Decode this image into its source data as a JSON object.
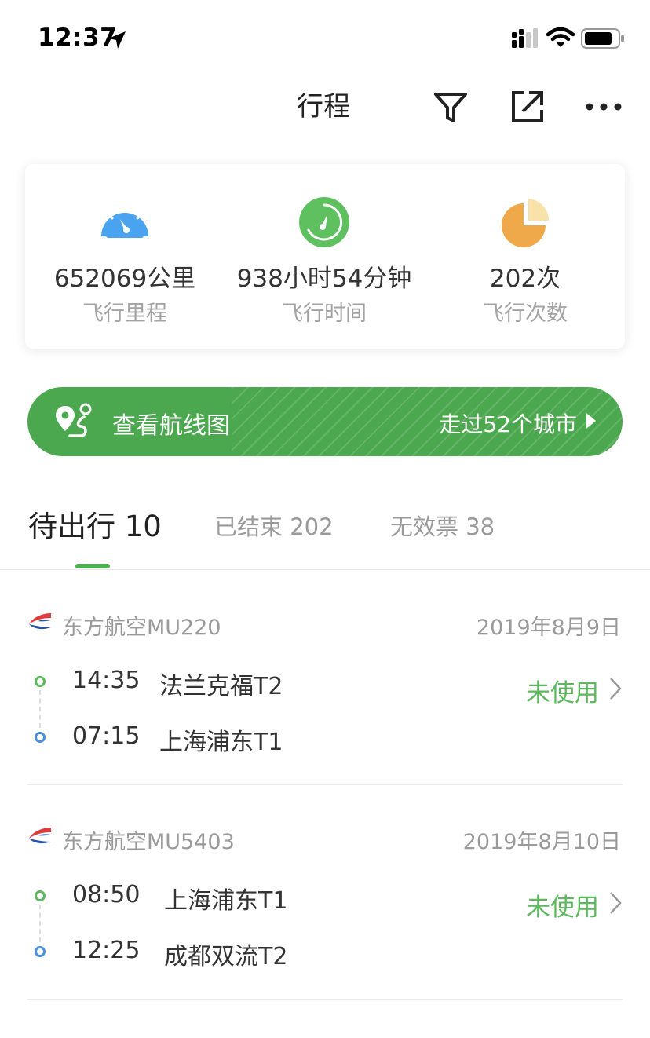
{
  "status_bar": {
    "time": "12:37"
  },
  "nav": {
    "title": "行程"
  },
  "stats": [
    {
      "value": "652069公里",
      "label": "飞行里程",
      "icon": "speedometer-icon",
      "color": "#4aa3ee"
    },
    {
      "value": "938小时54分钟",
      "label": "飞行时间",
      "icon": "clock-icon",
      "color": "#5fc05f"
    },
    {
      "value": "202次",
      "label": "飞行次数",
      "icon": "pie-chart-icon",
      "color": "#f0a94a"
    }
  ],
  "route_banner": {
    "label": "查看航线图",
    "cities": "走过52个城市"
  },
  "tabs": [
    {
      "label": "待出行 10",
      "active": true
    },
    {
      "label": "已结束 202",
      "active": false
    },
    {
      "label": "无效票 38",
      "active": false
    }
  ],
  "flights": [
    {
      "airline": "东方航空MU220",
      "date": "2019年8月9日",
      "departure": {
        "time": "14:35",
        "place": "法兰克福T2"
      },
      "arrival": {
        "time": "07:15",
        "place": "上海浦东T1"
      },
      "status": "未使用"
    },
    {
      "airline": "东方航空MU5403",
      "date": "2019年8月10日",
      "departure": {
        "time": "08:50",
        "place": "上海浦东T1"
      },
      "arrival": {
        "time": "12:25",
        "place": "成都双流T2"
      },
      "status": "未使用"
    }
  ],
  "colors": {
    "accent": "#4ca84f",
    "status": "#5cb85c",
    "arrival_dot": "#4a90e2"
  }
}
